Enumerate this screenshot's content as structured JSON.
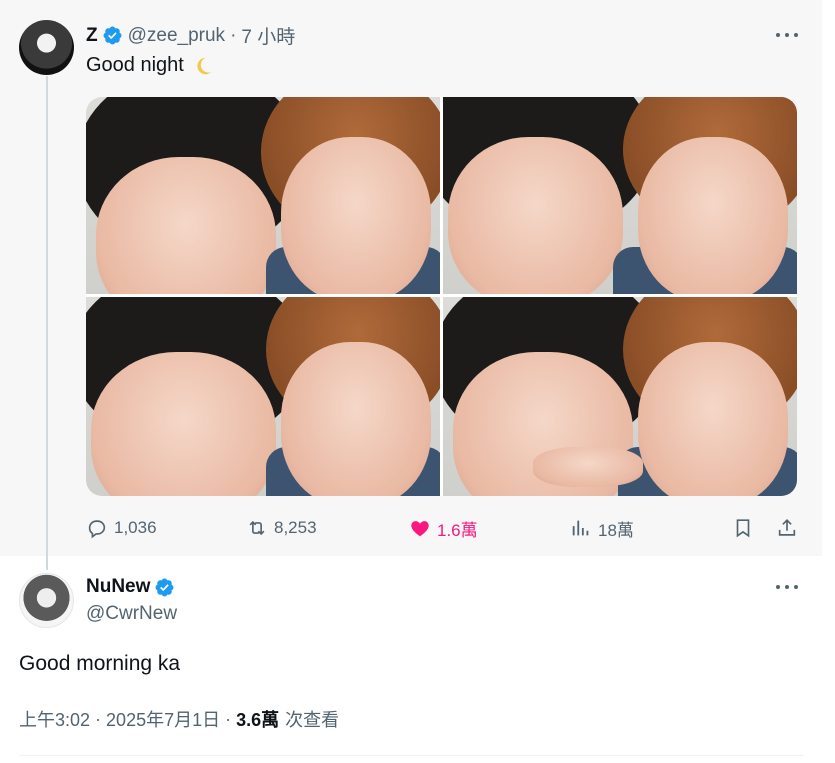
{
  "tweet1": {
    "author_name": "Z",
    "handle": "@zee_pruk",
    "time": "7 小時",
    "text": "Good night",
    "emoji_icon": "crescent-moon-icon",
    "actions": {
      "replies": "1,036",
      "retweets": "8,253",
      "likes": "1.6萬",
      "views": "18萬"
    }
  },
  "tweet2": {
    "author_name": "NuNew",
    "handle": "@CwrNew",
    "text": "Good morning ka",
    "time": "上午3:02",
    "date": "2025年7月1日",
    "views_count": "3.6萬",
    "views_label": "次查看"
  },
  "colors": {
    "verified": "#1d9bf0",
    "like": "#f91880",
    "muted": "#536471"
  }
}
